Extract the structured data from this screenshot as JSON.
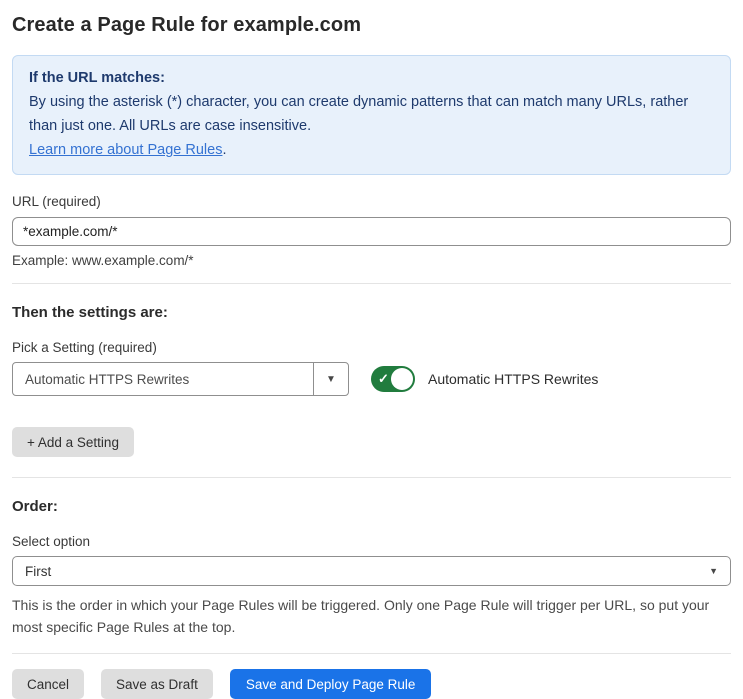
{
  "page": {
    "title": "Create a Page Rule for example.com"
  },
  "info_box": {
    "heading": "If the URL matches:",
    "body": "By using the asterisk (*) character, you can create dynamic patterns that can match many URLs, rather than just one. All URLs are case insensitive.",
    "link_label": "Learn more about Page Rules",
    "link_suffix": "."
  },
  "url_field": {
    "label": "URL (required)",
    "value": "*example.com/*",
    "helper": "Example: www.example.com/*"
  },
  "settings_section": {
    "heading": "Then the settings are:",
    "picker_label": "Pick a Setting (required)",
    "picker_value": "Automatic HTTPS Rewrites",
    "toggle_state": "on",
    "toggle_label": "Automatic HTTPS Rewrites",
    "add_setting_label": "+ Add a Setting"
  },
  "order_section": {
    "heading": "Order:",
    "select_label": "Select option",
    "select_value": "First",
    "helper": "This is the order in which your Page Rules will be triggered. Only one Page Rule will trigger per URL, so put your most specific Page Rules at the top."
  },
  "footer": {
    "cancel_label": "Cancel",
    "save_draft_label": "Save as Draft",
    "save_deploy_label": "Save and Deploy Page Rule"
  },
  "icons": {
    "caret_down": "▼",
    "check": "✓"
  },
  "colors": {
    "primary_blue": "#1a73e8",
    "toggle_green": "#217c3e",
    "info_background": "#e8f1fb",
    "info_border": "#c3daf3",
    "info_text": "#1e3a6d",
    "link_blue": "#3472d2",
    "button_gray": "#dedede"
  }
}
